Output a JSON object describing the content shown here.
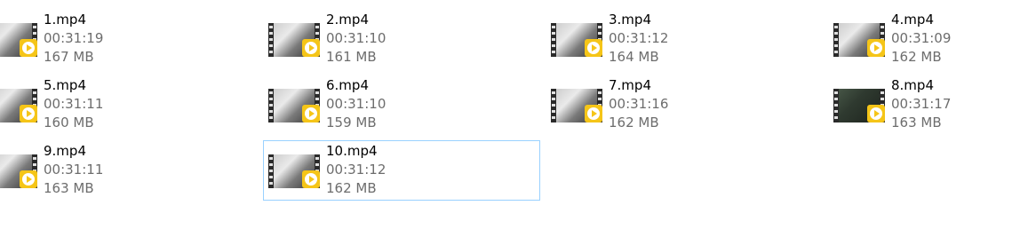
{
  "files": [
    {
      "name": "1.mp4",
      "duration": "00:31:19",
      "size": "167 MB",
      "thumb_icon": "video-thumbnail-icon",
      "play_icon": "play-icon"
    },
    {
      "name": "2.mp4",
      "duration": "00:31:10",
      "size": "161 MB",
      "thumb_icon": "video-thumbnail-icon",
      "play_icon": "play-icon"
    },
    {
      "name": "3.mp4",
      "duration": "00:31:12",
      "size": "164 MB",
      "thumb_icon": "video-thumbnail-icon",
      "play_icon": "play-icon"
    },
    {
      "name": "4.mp4",
      "duration": "00:31:09",
      "size": "162 MB",
      "thumb_icon": "video-thumbnail-icon",
      "play_icon": "play-icon"
    },
    {
      "name": "5.mp4",
      "duration": "00:31:11",
      "size": "160 MB",
      "thumb_icon": "video-thumbnail-icon",
      "play_icon": "play-icon"
    },
    {
      "name": "6.mp4",
      "duration": "00:31:10",
      "size": "159 MB",
      "thumb_icon": "video-thumbnail-icon",
      "play_icon": "play-icon"
    },
    {
      "name": "7.mp4",
      "duration": "00:31:16",
      "size": "162 MB",
      "thumb_icon": "video-thumbnail-icon",
      "play_icon": "play-icon"
    },
    {
      "name": "8.mp4",
      "duration": "00:31:17",
      "size": "163 MB",
      "thumb_icon": "video-thumbnail-icon",
      "play_icon": "play-icon"
    },
    {
      "name": "9.mp4",
      "duration": "00:31:11",
      "size": "163 MB",
      "thumb_icon": "video-thumbnail-icon",
      "play_icon": "play-icon"
    },
    {
      "name": "10.mp4",
      "duration": "00:31:12",
      "size": "162 MB",
      "thumb_icon": "video-thumbnail-icon",
      "play_icon": "play-icon",
      "selected": true
    }
  ],
  "colors": {
    "selection_border": "#99d1ff",
    "play_badge": "#f5c518",
    "name_text": "#000000",
    "meta_text": "#6d6d6d"
  }
}
